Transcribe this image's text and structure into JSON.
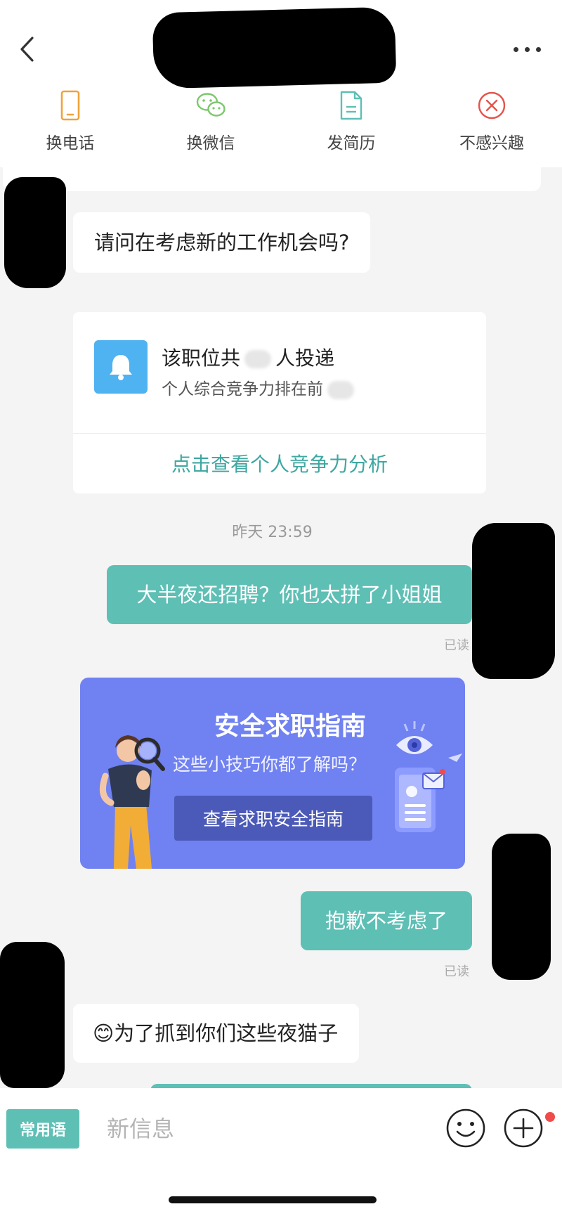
{
  "header": {
    "actions": [
      {
        "label": "换电话",
        "icon": "phone-icon",
        "color": "#f0a33a"
      },
      {
        "label": "换微信",
        "icon": "wechat-icon",
        "color": "#7bc86c"
      },
      {
        "label": "发简历",
        "icon": "resume-icon",
        "color": "#5ebfb5"
      },
      {
        "label": "不感兴趣",
        "icon": "not-interested-icon",
        "color": "#e5534b"
      }
    ]
  },
  "messages": {
    "m1": "请问在考虑新的工作机会吗?",
    "m2": "大半夜还招聘？你也太拼了小姐姐",
    "m3": "抱歉不考虑了",
    "m4_emoji": "😊",
    "m4": "为了抓到你们这些夜猫子",
    "read": "已读"
  },
  "stats": {
    "line1_prefix": "该职位共",
    "line1_suffix": "人投递",
    "line2": "个人综合竞争力排在前",
    "link": "点击查看个人竞争力分析"
  },
  "timestamp": "昨天 23:59",
  "safety": {
    "title": "安全求职指南",
    "subtitle": "这些小技巧你都了解吗？",
    "button": "查看求职安全指南"
  },
  "input": {
    "phrases_label": "常用语",
    "placeholder": "新信息"
  },
  "colors": {
    "accent": "#5ebfb5",
    "banner": "#7081f1",
    "bell": "#4fb2f1",
    "notification": "#ef4b4b"
  }
}
